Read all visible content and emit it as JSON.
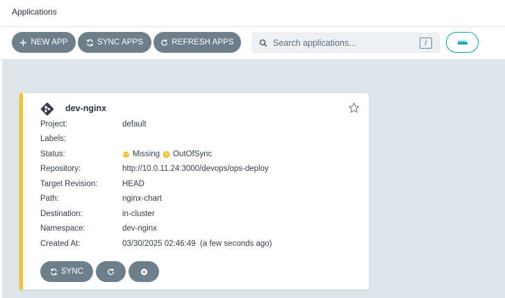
{
  "header": {
    "title": "Applications"
  },
  "toolbar": {
    "new_app": "NEW APP",
    "sync_apps": "SYNC APPS",
    "refresh_apps": "REFRESH APPS",
    "search_placeholder": "Search applications...",
    "search_shortcut": "/"
  },
  "colors": {
    "button": "#6d7f8b",
    "accent": "#00a2b3",
    "out_of_sync": "#f4c030",
    "background": "#dee6eb"
  },
  "app": {
    "name": "dev-nginx",
    "fields": [
      {
        "label": "Project:",
        "value": "default"
      },
      {
        "label": "Labels:",
        "value": ""
      },
      {
        "label": "Status:",
        "value": ""
      },
      {
        "label": "Repository:",
        "value": "http://10.0.11.24:3000/devops/ops-deploy"
      },
      {
        "label": "Target Revision:",
        "value": "HEAD"
      },
      {
        "label": "Path:",
        "value": "nginx-chart"
      },
      {
        "label": "Destination:",
        "value": "in-cluster"
      },
      {
        "label": "Namespace:",
        "value": "dev-nginx"
      },
      {
        "label": "Created At:",
        "value": "03/30/2025 02:46:49  (a few seconds ago)"
      }
    ],
    "health_status": "Missing",
    "sync_status": "OutOfSync",
    "sync_label": "SYNC"
  }
}
